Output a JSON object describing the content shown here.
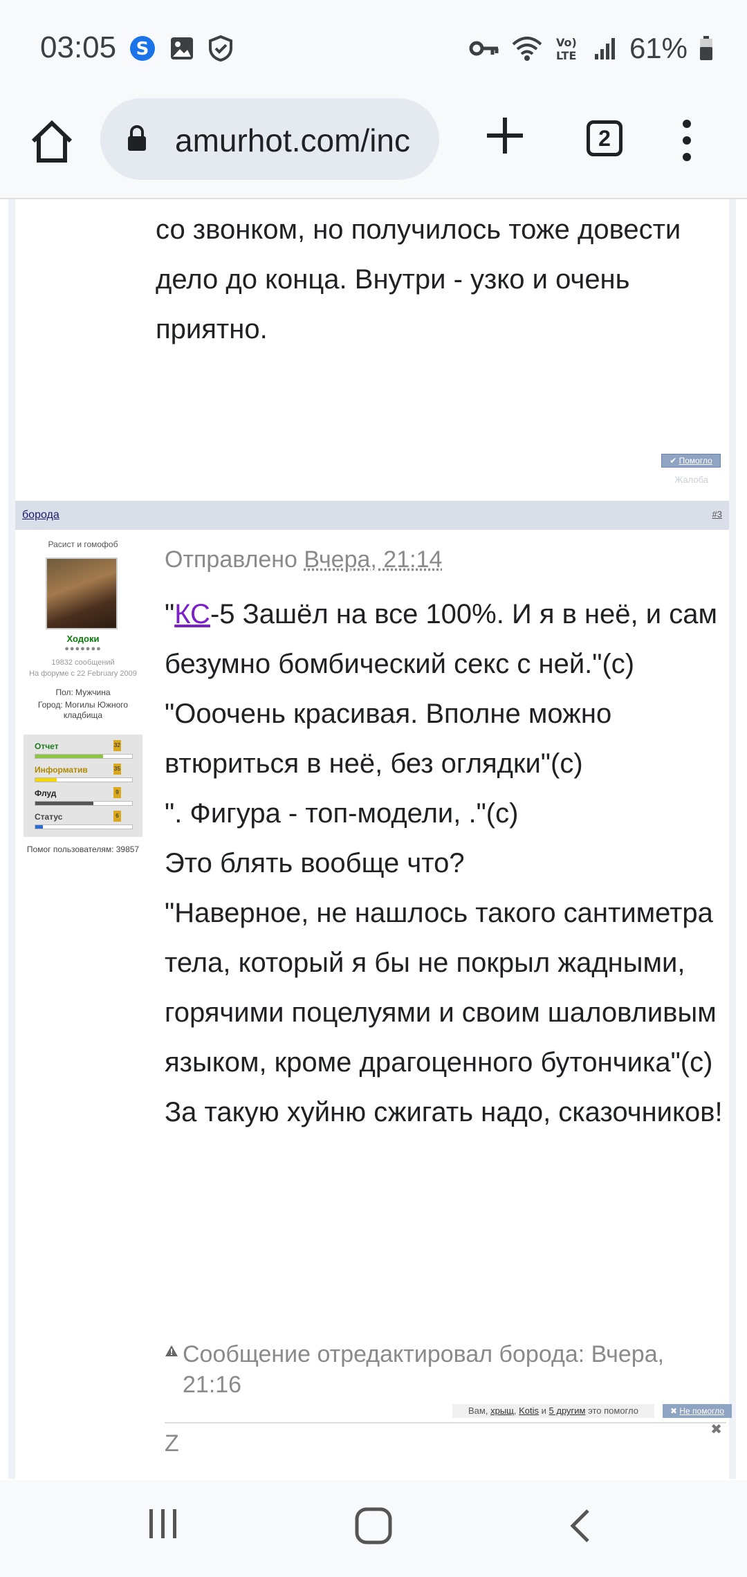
{
  "status_bar": {
    "time": "03:05",
    "battery": "61%",
    "icons": [
      "skype-icon",
      "image-icon",
      "shield-icon",
      "key-icon",
      "wifi-icon",
      "volte-icon",
      "signal-icon",
      "battery-icon"
    ]
  },
  "browser": {
    "url": "amurhot.com/inc",
    "tab_count": "2",
    "icons": [
      "home-icon",
      "lock-icon",
      "plus-icon",
      "tabs-icon",
      "more-vert-icon"
    ]
  },
  "post1": {
    "text": "со звонком, но получилось тоже довести дело до конца. Внутри - узко и очень приятно.",
    "pomoglo_label": "Помогло",
    "report_label": "Жалоба"
  },
  "post2": {
    "author_bar": "борода",
    "post_number": "#3",
    "user": {
      "rank": "Расист и гомофоб",
      "name": "Ходоки",
      "stars": "●●●●●●●",
      "messages": "19832 сообщений",
      "since": "На форуме с 22 February 2009",
      "gender": "Пол: Мужчина",
      "city": "Город: Могилы Южного кладбища",
      "help": "Помог пользователям: 39857",
      "ratings": [
        {
          "label": "Отчет",
          "value": "32",
          "color": "#1a7a1a",
          "fill": 0.7,
          "fillColor": "#8cc63f"
        },
        {
          "label": "Информатив",
          "value": "35",
          "color": "#b08a00",
          "fill": 0.22,
          "fillColor": "#f5d800"
        },
        {
          "label": "Флуд",
          "value": "9",
          "color": "#222222",
          "fill": 0.6,
          "fillColor": "#555555"
        },
        {
          "label": "Статус",
          "value": "6",
          "color": "#444444",
          "fill": 0.08,
          "fillColor": "#2a6bd1"
        }
      ]
    },
    "sent_prefix": "Отправлено",
    "sent_date": "Вчера, 21:14",
    "quote_open": "\"",
    "link_text": "КС",
    "line1_rest": "-5 Зашёл на все 100%. И я в неё, и сам безумно бомбический секс с ней.\"(с)",
    "line2": "\"Ооочень красивая. Вполне можно втюриться в неё, без оглядки\"(с)",
    "line3": "\". Фигура - топ-модели, .\"(с)",
    "line4": "Это блять вообще что?",
    "line5": "\"Наверное, не нашлось такого сантиметра тела, который я бы не покрыл жадными, горячими поцелуями и своим шаловливым языком, кроме драгоценного бутончика\"(с)",
    "line6": "За такую хуйню сжигать надо, сказочников!",
    "edited": "Сообщение отредактировал борода: Вчера, 21:16",
    "helped_prefix": "Вам,",
    "helped_user1": "хрыщ",
    "helped_sep": ",",
    "helped_user2": "Kotis",
    "helped_and": "и",
    "helped_others": "5 другим",
    "helped_suffix": "это помогло",
    "nepomoglo_label": "Не помогло",
    "signature": "Z"
  },
  "navbar": {
    "icons": [
      "recent-apps-icon",
      "home-nav-icon",
      "back-icon"
    ]
  }
}
